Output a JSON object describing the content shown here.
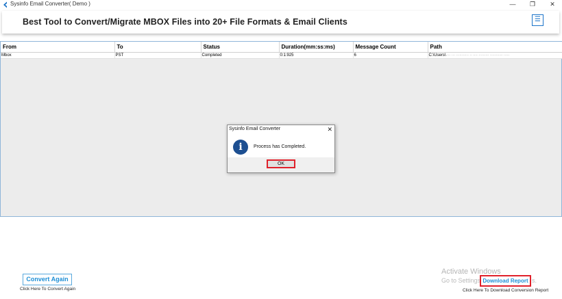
{
  "window": {
    "title": "Sysinfo Email Converter( Demo )",
    "minimize_glyph": "—",
    "restore_glyph": "❐",
    "close_glyph": "✕"
  },
  "header": {
    "title": "Best Tool to Convert/Migrate MBOX Files into 20+ File Formats & Email Clients",
    "menu_icon": "☰"
  },
  "table": {
    "columns": [
      "From",
      "To",
      "Status",
      "Duration(mm:ss:ms)",
      "Message Count",
      "Path"
    ],
    "rows": [
      {
        "from": "Mbox",
        "to": "PST",
        "status": "Completed",
        "duration": "0:1:925",
        "message_count": "6",
        "path": "C:\\Users\\",
        "path_obscured": "···· ··· ··········· ·· ···· ········· ··········· ·····"
      }
    ]
  },
  "dialog": {
    "title": "Sysinfo Email Converter",
    "close_glyph": "✕",
    "icon_glyph": "i",
    "message": "Process has Completed.",
    "ok_label": "OK"
  },
  "footer": {
    "convert_again_label": "Convert Again",
    "convert_again_caption": "Click Here To Convert Again",
    "download_report_label": "Download Report",
    "download_report_caption": "Click Here To Download Conversion Report"
  },
  "watermark": {
    "line1": "Activate Windows",
    "line2": "Go to Settings",
    "line2_tail": "s."
  },
  "colors": {
    "accent": "#1f8fd6",
    "highlight": "#e0202a",
    "info_icon": "#1d4f91"
  }
}
